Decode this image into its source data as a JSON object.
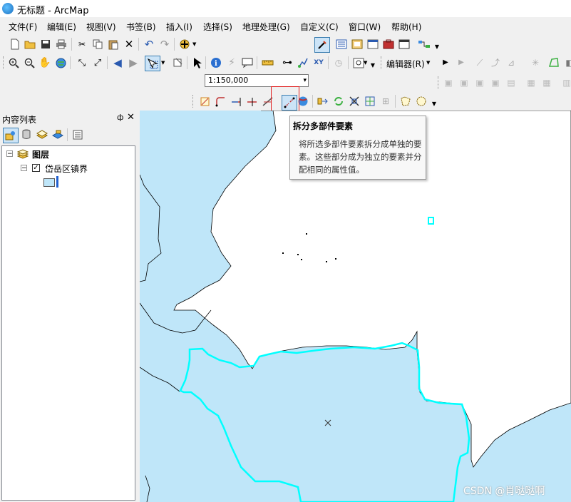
{
  "window": {
    "title": "无标题 - ArcMap"
  },
  "menu": [
    "文件(F)",
    "编辑(E)",
    "视图(V)",
    "书签(B)",
    "插入(I)",
    "选择(S)",
    "地理处理(G)",
    "自定义(C)",
    "窗口(W)",
    "帮助(H)"
  ],
  "toolbar": {
    "scale_value": "1:150,000",
    "editor_label": "编辑器(R)"
  },
  "tooltip": {
    "title": "拆分多部件要素",
    "body": "将所选多部件要素拆分成单独的要素。这些部分成为独立的要素并分配相同的属性值。"
  },
  "toc": {
    "title": "内容列表",
    "pin": "ф",
    "close": "✕",
    "group_label": "图层",
    "layer_label": "岱岳区镇界"
  },
  "colors": {
    "map_fill": "#bfe6f9",
    "selection": "#00ffff",
    "highlight_box": "#e02020"
  },
  "watermark": "CSDN @肖哒哒啊"
}
